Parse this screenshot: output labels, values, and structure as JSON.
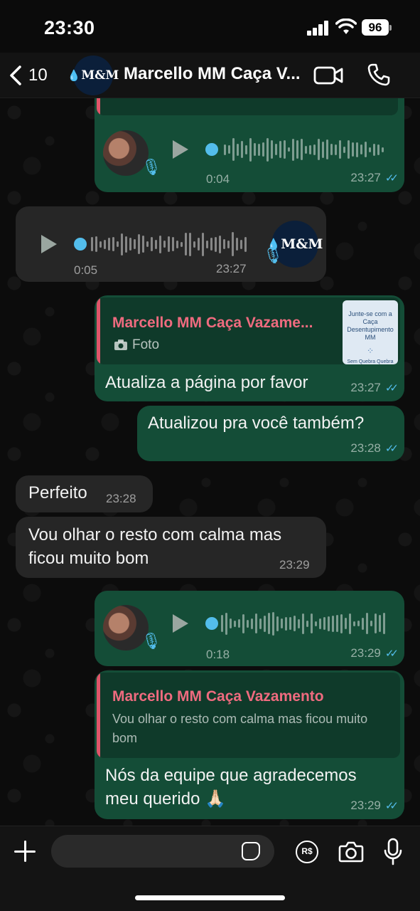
{
  "status_bar": {
    "time": "23:30",
    "battery": "96"
  },
  "header": {
    "back_count": "10",
    "avatar_text": "M&M",
    "title": "Marcello MM Caça V..."
  },
  "messages": {
    "voice1": {
      "duration": "0:04",
      "time": "23:27"
    },
    "voice2": {
      "duration": "0:05",
      "time": "23:27",
      "avatar_text": "M&M"
    },
    "reply1": {
      "quote_author": "Marcello MM Caça Vazame...",
      "quote_type": "Foto",
      "thumb_lines": [
        "Junte-se com a",
        "Caça",
        "Desentupimento MM",
        "Sem Quebra Quebra"
      ],
      "text": "Atualiza a página por favor",
      "time": "23:27"
    },
    "out1": {
      "text": "Atualizou pra você também?",
      "time": "23:28"
    },
    "in1": {
      "text": "Perfeito",
      "time": "23:28"
    },
    "in2": {
      "text": "Vou olhar o resto com calma mas ficou muito bom",
      "time": "23:29"
    },
    "voice3": {
      "duration": "0:18",
      "time": "23:29"
    },
    "reply2": {
      "quote_author": "Marcello MM Caça Vazamento",
      "quote_text": "Vou olhar o resto com calma mas ficou muito bom",
      "text": "Nós da equipe que agradecemos meu querido 🙏🏻",
      "time": "23:29"
    }
  },
  "composer": {
    "placeholder": "",
    "pay_label": "R$"
  },
  "colors": {
    "outgoing": "#144d37",
    "incoming": "#262626",
    "read_ticks": "#53bdeb",
    "quote_author": "#ef6b7f"
  }
}
